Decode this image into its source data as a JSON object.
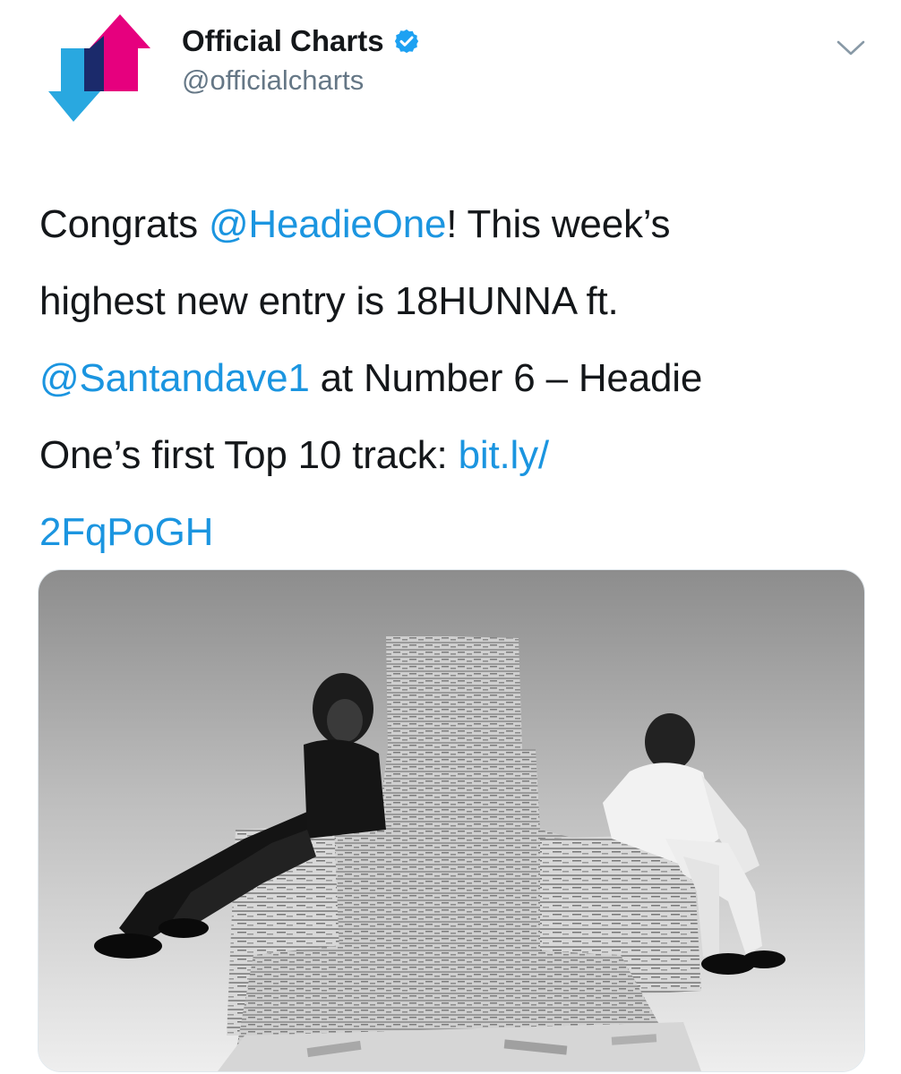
{
  "account": {
    "display_name": "Official Charts",
    "handle": "@officialcharts",
    "verified_icon": "verified-badge-icon",
    "logo_icon": "official-charts-logo-icon",
    "logo_colors": {
      "pink": "#e6007e",
      "blue": "#29a8e0",
      "dark": "#1b2a6b"
    }
  },
  "menu": {
    "icon": "chevron-down-icon"
  },
  "tweet": {
    "line1": {
      "a": "Congrats ",
      "mention": "@HeadieOne",
      "b": "! This week’s"
    },
    "line2": "highest new entry is 18HUNNA ft.",
    "line3": {
      "mention": "@Santandave1",
      "b": " at Number 6 – Headie"
    },
    "line4": {
      "a": "One’s first Top 10 track: ",
      "link": "bit.ly/"
    },
    "line5": {
      "link": "2FqPoGH"
    },
    "link_color": "#1b95e0"
  },
  "media": {
    "image": "black-and-white-photo-two-men-seated-against-stacks-of-cash"
  }
}
